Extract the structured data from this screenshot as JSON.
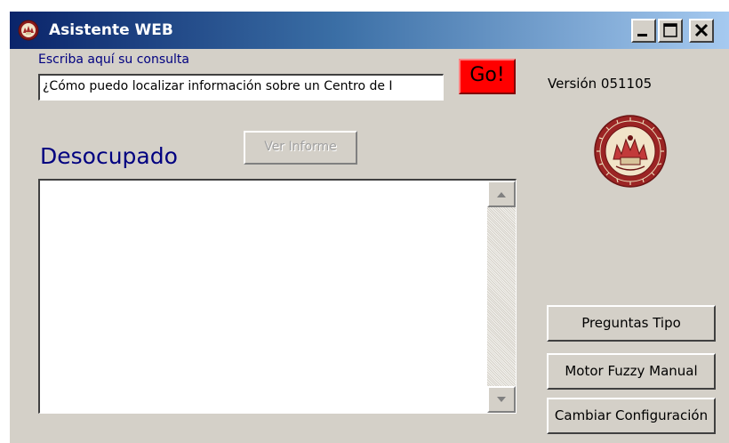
{
  "window": {
    "title": "Asistente WEB"
  },
  "icons": {
    "app": "university-seal-icon",
    "minimize": "minimize-icon",
    "maximize": "maximize-icon",
    "close": "close-icon",
    "seal": "university-seal-icon",
    "scroll_up": "arrow-up-icon",
    "scroll_down": "arrow-down-icon"
  },
  "query": {
    "label": "Escriba aquí su consulta",
    "value": "¿Cómo puedo localizar información sobre un Centro de I"
  },
  "go_button": {
    "label": "Go!",
    "color": "#ff0000"
  },
  "version": "Versión 051105",
  "status": {
    "text": "Desocupado",
    "color": "#000080"
  },
  "report_button": {
    "label": "Ver Informe",
    "enabled": false
  },
  "results": {
    "text": ""
  },
  "side_buttons": {
    "preguntas": "Preguntas Tipo",
    "motor": "Motor Fuzzy Manual",
    "cambiar": "Cambiar Configuración"
  },
  "colors": {
    "title_bar": "#0a246a",
    "window_face": "#d4d0c8"
  }
}
